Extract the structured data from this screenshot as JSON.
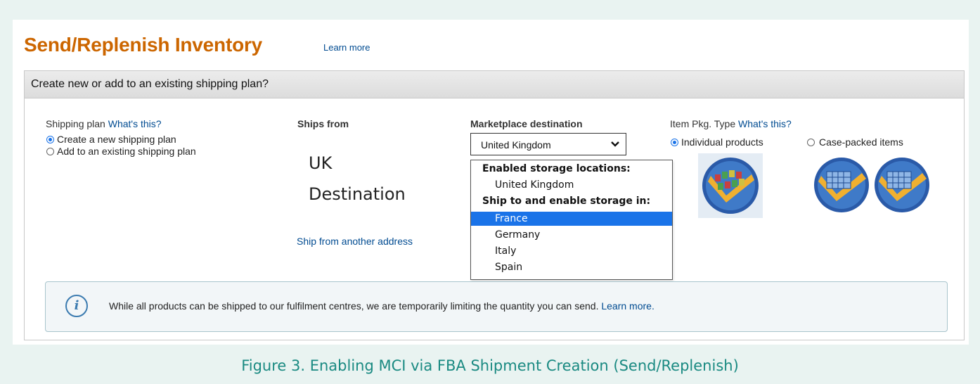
{
  "header": {
    "title": "Send/Replenish Inventory",
    "learn_more": "Learn more"
  },
  "section": {
    "title": "Create new or add to an existing shipping plan?"
  },
  "shipping_plan": {
    "label": "Shipping plan",
    "whats_this": "What's this?",
    "options": [
      "Create a new shipping plan",
      "Add to an existing shipping plan"
    ],
    "selected": "Create a new shipping plan"
  },
  "ships_from": {
    "label": "Ships from",
    "address_line1": "UK",
    "address_line2": "Destination",
    "other_address_link": "Ship from another address"
  },
  "marketplace": {
    "label": "Marketplace destination",
    "selected": "United Kingdom",
    "dropdown": {
      "enabled_header": "Enabled storage locations:",
      "enabled": [
        "United Kingdom"
      ],
      "ship_header": "Ship to and enable storage in:",
      "ship_to": [
        "France",
        "Germany",
        "Italy",
        "Spain"
      ],
      "highlighted": "France"
    }
  },
  "pkg_type": {
    "label": "Item Pkg. Type",
    "whats_this": "What's this?",
    "options": [
      "Individual products",
      "Case-packed items"
    ],
    "selected": "Individual products"
  },
  "notice": {
    "text": "While all products can be shipped to our fulfilment centres, we are temporarily limiting the quantity you can send.",
    "link": "Learn more."
  },
  "caption": "Figure 3. Enabling MCI via FBA Shipment Creation (Send/Replenish)",
  "colors": {
    "title": "#cc6600",
    "link": "#004b91",
    "highlight": "#1a73e8",
    "caption": "#1a8a82"
  }
}
